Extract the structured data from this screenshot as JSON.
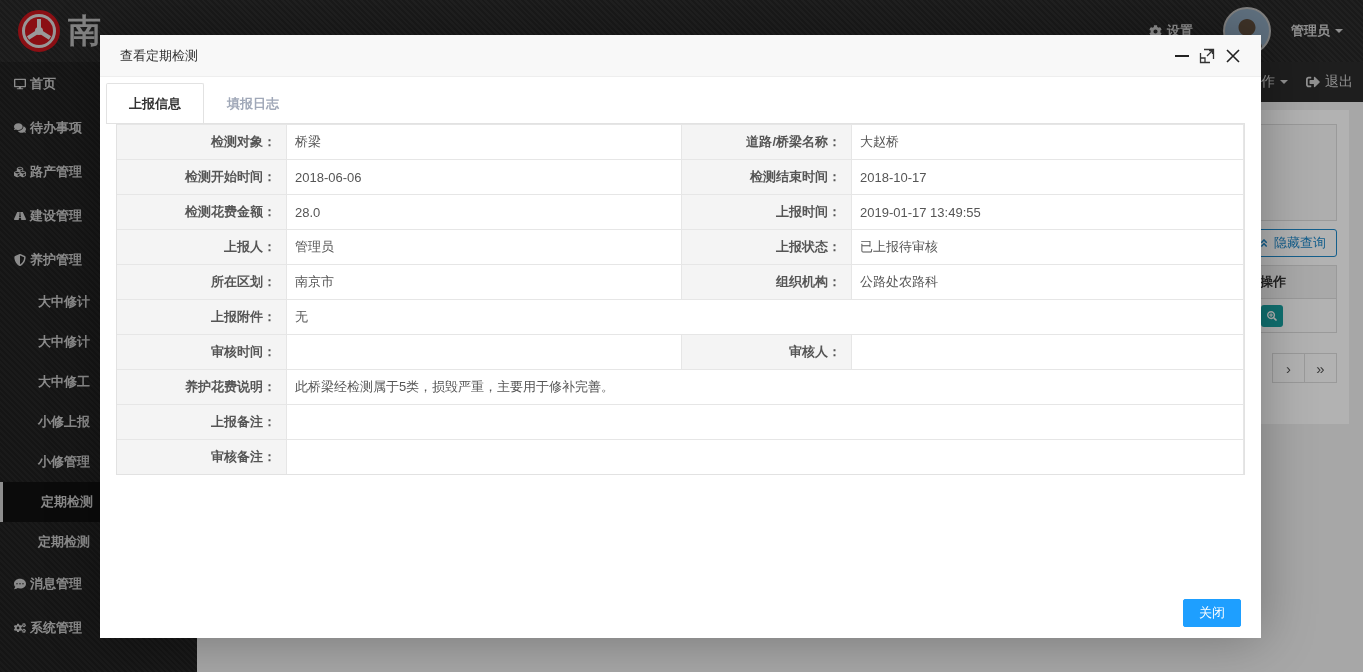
{
  "header": {
    "title": "南",
    "settings_label": "设置",
    "user_name": "管理员"
  },
  "topbar": {
    "actions_label": "作",
    "logout_label": "退出"
  },
  "sidebar": {
    "items": [
      {
        "label": "首页",
        "selected": false
      },
      {
        "label": "待办事项",
        "selected": false
      },
      {
        "label": "路产管理",
        "selected": false
      },
      {
        "label": "建设管理",
        "selected": false
      },
      {
        "label": "养护管理",
        "selected": false,
        "children": [
          {
            "label": "大中修计",
            "selected": false
          },
          {
            "label": "大中修计",
            "selected": false
          },
          {
            "label": "大中修工",
            "selected": false
          },
          {
            "label": "小修上报",
            "selected": false
          },
          {
            "label": "小修管理",
            "selected": false
          },
          {
            "label": "定期检测",
            "selected": true
          },
          {
            "label": "定期检测",
            "selected": false
          }
        ]
      },
      {
        "label": "消息管理",
        "selected": false
      },
      {
        "label": "系统管理",
        "selected": false
      }
    ]
  },
  "main": {
    "toggle_query_button": "隐藏查询",
    "table_header": "操作",
    "pagination": [
      "›",
      "»"
    ]
  },
  "dialog": {
    "title": "查看定期检测",
    "tabs": [
      {
        "label": "上报信息",
        "selected": true
      },
      {
        "label": "填报日志",
        "selected": false
      }
    ],
    "rows": [
      {
        "cells": [
          {
            "label": "检测对象：",
            "value": "桥梁"
          },
          {
            "label": "道路/桥梁名称：",
            "value": "大赵桥"
          }
        ]
      },
      {
        "cells": [
          {
            "label": "检测开始时间：",
            "value": "2018-06-06"
          },
          {
            "label": "检测结束时间：",
            "value": "2018-10-17"
          }
        ]
      },
      {
        "cells": [
          {
            "label": "检测花费金额：",
            "value": "28.0"
          },
          {
            "label": "上报时间：",
            "value": "2019-01-17 13:49:55"
          }
        ]
      },
      {
        "cells": [
          {
            "label": "上报人：",
            "value": "管理员"
          },
          {
            "label": "上报状态：",
            "value": "已上报待审核"
          }
        ]
      },
      {
        "cells": [
          {
            "label": "所在区划：",
            "value": "南京市"
          },
          {
            "label": "组织机构：",
            "value": "公路处农路科"
          }
        ]
      },
      {
        "cells": [
          {
            "label": "上报附件：",
            "value": "无"
          }
        ]
      },
      {
        "cells": [
          {
            "label": "审核时间："
          },
          {
            "label": "审核人："
          }
        ]
      },
      {
        "cells": [
          {
            "label": "养护花费说明：",
            "value": "此桥梁经检测属于5类，损毁严重，主要用于修补完善。"
          }
        ]
      },
      {
        "cells": [
          {
            "label": "上报备注："
          }
        ]
      },
      {
        "cells": [
          {
            "label": "审核备注："
          }
        ]
      }
    ],
    "close_button": "关闭"
  }
}
